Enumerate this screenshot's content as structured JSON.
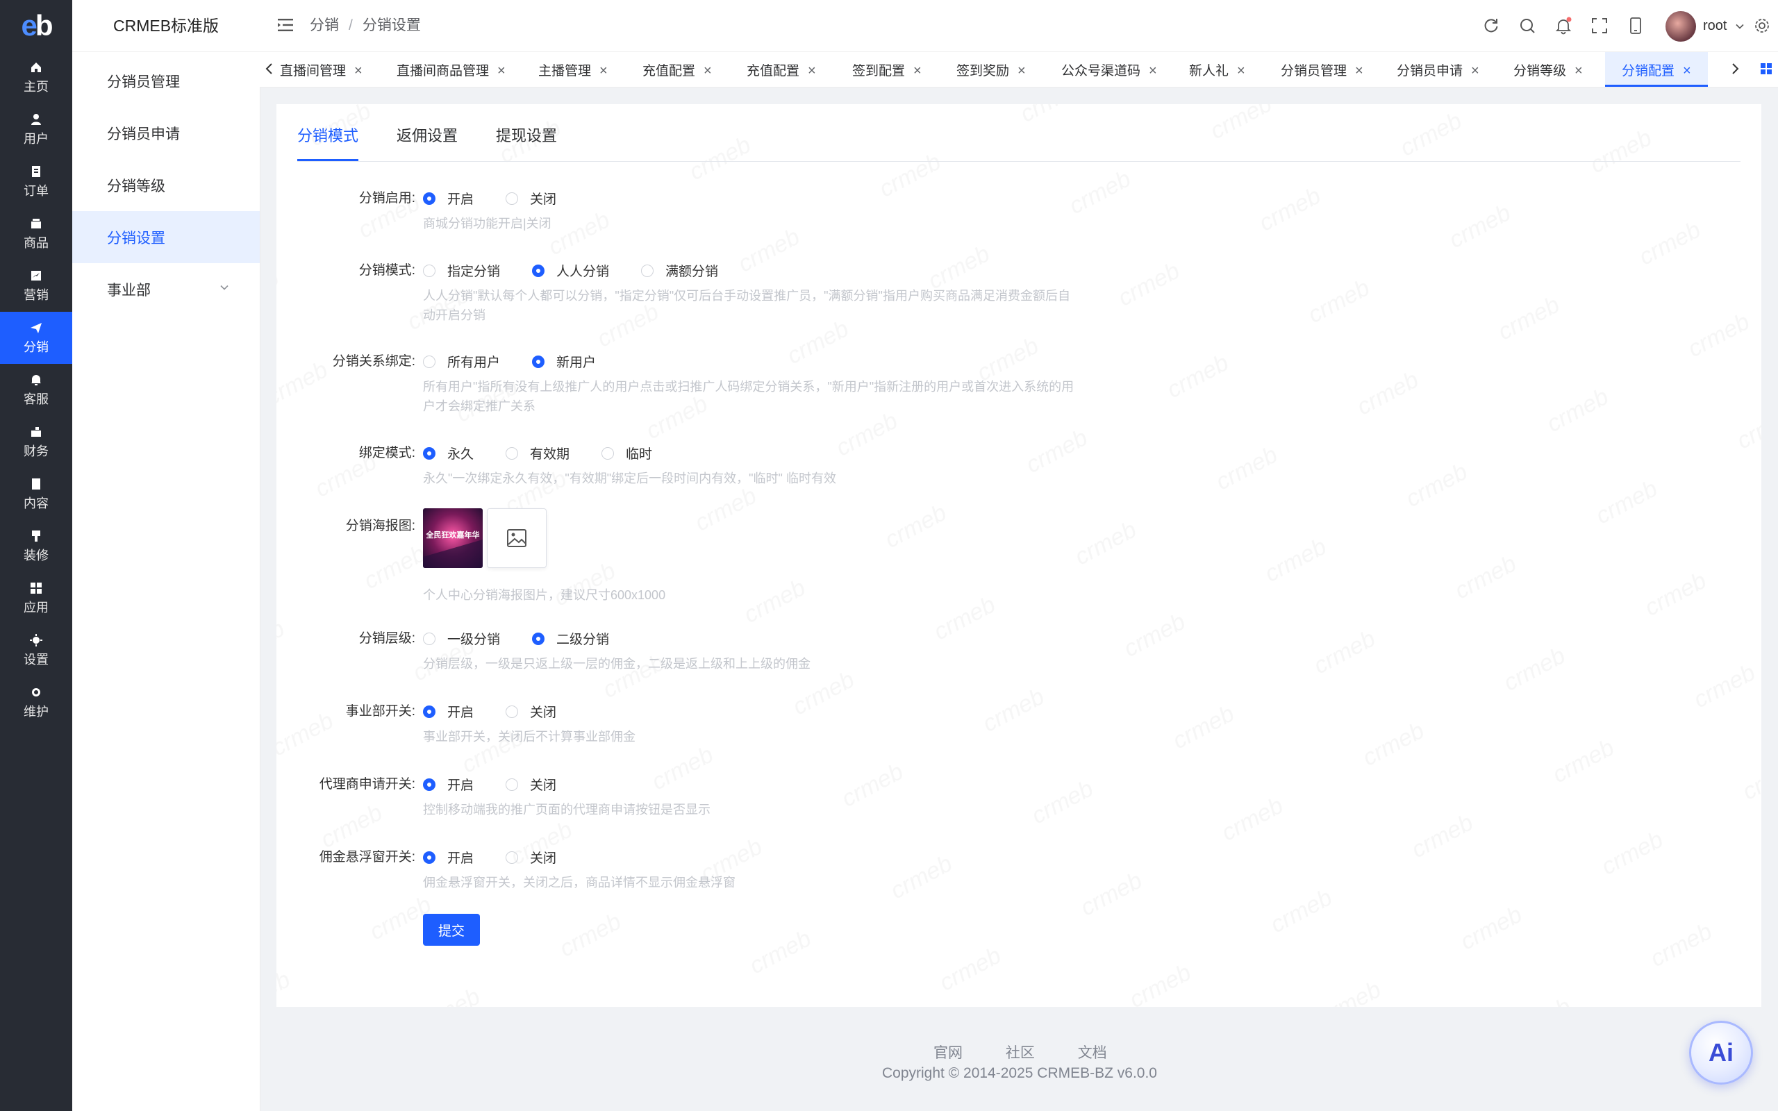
{
  "brand": {
    "logo": "eb",
    "app_title": "CRMEB标准版"
  },
  "rail": [
    {
      "label": "主页",
      "icon": "home-icon"
    },
    {
      "label": "用户",
      "icon": "user-icon"
    },
    {
      "label": "订单",
      "icon": "order-icon"
    },
    {
      "label": "商品",
      "icon": "product-icon"
    },
    {
      "label": "营销",
      "icon": "marketing-icon"
    },
    {
      "label": "分销",
      "icon": "distribution-icon",
      "active": true
    },
    {
      "label": "客服",
      "icon": "bell-icon"
    },
    {
      "label": "财务",
      "icon": "finance-icon"
    },
    {
      "label": "内容",
      "icon": "content-icon"
    },
    {
      "label": "装修",
      "icon": "decorate-icon"
    },
    {
      "label": "应用",
      "icon": "apps-icon"
    },
    {
      "label": "设置",
      "icon": "gear-icon"
    },
    {
      "label": "维护",
      "icon": "maintain-icon"
    }
  ],
  "submenu": {
    "items": [
      {
        "label": "分销员管理"
      },
      {
        "label": "分销员申请"
      },
      {
        "label": "分销等级"
      },
      {
        "label": "分销设置",
        "active": true
      },
      {
        "label": "事业部",
        "expandable": true
      }
    ]
  },
  "header": {
    "breadcrumb": [
      "分销",
      "分销设置"
    ],
    "breadcrumb_sep": "/",
    "user": "root"
  },
  "tabs": [
    {
      "label": "直播间管理"
    },
    {
      "label": "直播间商品管理"
    },
    {
      "label": "主播管理"
    },
    {
      "label": "充值配置"
    },
    {
      "label": "充值配置"
    },
    {
      "label": "签到配置"
    },
    {
      "label": "签到奖励"
    },
    {
      "label": "公众号渠道码"
    },
    {
      "label": "新人礼"
    },
    {
      "label": "分销员管理"
    },
    {
      "label": "分销员申请"
    },
    {
      "label": "分销等级"
    },
    {
      "label": "分销配置",
      "active": true
    }
  ],
  "content_tabs": [
    {
      "label": "分销模式",
      "active": true
    },
    {
      "label": "返佣设置"
    },
    {
      "label": "提现设置"
    }
  ],
  "form": {
    "enable": {
      "label": "分销启用:",
      "options": [
        "开启",
        "关闭"
      ],
      "selected": 0,
      "help": "商城分销功能开启|关闭"
    },
    "mode": {
      "label": "分销模式:",
      "options": [
        "指定分销",
        "人人分销",
        "满额分销"
      ],
      "selected": 1,
      "help": "人人分销\"默认每个人都可以分销，\"指定分销\"仅可后台手动设置推广员，\"满额分销\"指用户购买商品满足消费金额后自动开启分销"
    },
    "binding": {
      "label": "分销关系绑定:",
      "options": [
        "所有用户",
        "新用户"
      ],
      "selected": 1,
      "help": "所有用户\"指所有没有上级推广人的用户点击或扫推广人码绑定分销关系，\"新用户\"指新注册的用户或首次进入系统的用户才会绑定推广关系"
    },
    "bind_mode": {
      "label": "绑定模式:",
      "options": [
        "永久",
        "有效期",
        "临时"
      ],
      "selected": 0,
      "help": "永久\"一次绑定永久有效，\"有效期\"绑定后一段时间内有效，\"临时\" 临时有效"
    },
    "poster": {
      "label": "分销海报图:",
      "help": "个人中心分销海报图片，建议尺寸600x1000",
      "poster_text": "全民狂欢嘉年华"
    },
    "levels": {
      "label": "分销层级:",
      "options": [
        "一级分销",
        "二级分销"
      ],
      "selected": 1,
      "help": "分销层级，一级是只返上级一层的佣金，二级是返上级和上上级的佣金"
    },
    "division": {
      "label": "事业部开关:",
      "options": [
        "开启",
        "关闭"
      ],
      "selected": 0,
      "help": "事业部开关，关闭后不计算事业部佣金"
    },
    "agent": {
      "label": "代理商申请开关:",
      "options": [
        "开启",
        "关闭"
      ],
      "selected": 0,
      "help": "控制移动端我的推广页面的代理商申请按钮是否显示"
    },
    "float": {
      "label": "佣金悬浮窗开关:",
      "options": [
        "开启",
        "关闭"
      ],
      "selected": 0,
      "help": "佣金悬浮窗开关，关闭之后，商品详情不显示佣金悬浮窗"
    },
    "submit_label": "提交"
  },
  "footer": {
    "links": [
      "官网",
      "社区",
      "文档"
    ],
    "copyright": "Copyright © 2014-2025 CRMEB-BZ v6.0.0"
  },
  "ai_label": "Ai",
  "watermark": "crmeb",
  "colors": {
    "primary": "#1e5eff",
    "rail_bg": "#282c34",
    "active_bg": "#e8f0ff"
  }
}
